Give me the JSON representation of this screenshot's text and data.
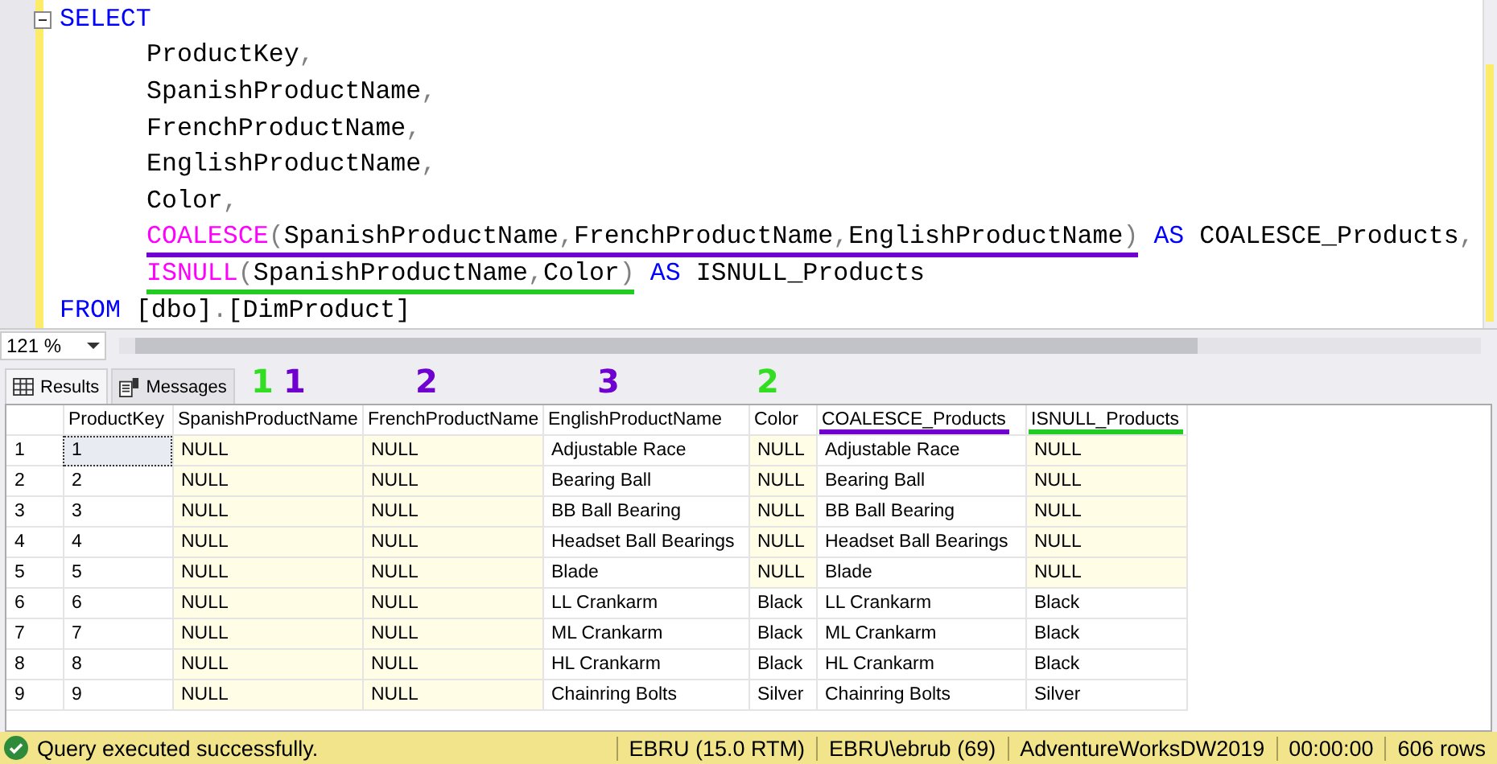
{
  "editor": {
    "lines": [
      {
        "kind": "clause",
        "segments": [
          {
            "tokens": [
              {
                "kind": "keyword",
                "text": "SELECT"
              }
            ]
          }
        ]
      },
      {
        "kind": "item",
        "segments": [
          {
            "tokens": [
              {
                "kind": "plain",
                "text": "ProductKey"
              },
              {
                "kind": "gray",
                "text": ","
              }
            ]
          }
        ]
      },
      {
        "kind": "item",
        "segments": [
          {
            "tokens": [
              {
                "kind": "plain",
                "text": "SpanishProductName"
              },
              {
                "kind": "gray",
                "text": ","
              }
            ]
          }
        ]
      },
      {
        "kind": "item",
        "segments": [
          {
            "tokens": [
              {
                "kind": "plain",
                "text": "FrenchProductName"
              },
              {
                "kind": "gray",
                "text": ","
              }
            ]
          }
        ]
      },
      {
        "kind": "item",
        "segments": [
          {
            "tokens": [
              {
                "kind": "plain",
                "text": "EnglishProductName"
              },
              {
                "kind": "gray",
                "text": ","
              }
            ]
          }
        ]
      },
      {
        "kind": "item",
        "segments": [
          {
            "tokens": [
              {
                "kind": "plain",
                "text": "Color"
              },
              {
                "kind": "gray",
                "text": ","
              }
            ]
          }
        ]
      },
      {
        "kind": "item",
        "segments": [
          {
            "color": "#7000d0",
            "tokens": [
              {
                "kind": "func",
                "text": "COALESCE"
              },
              {
                "kind": "gray",
                "text": "("
              },
              {
                "kind": "plain",
                "text": "SpanishProductName"
              },
              {
                "kind": "gray",
                "text": ","
              },
              {
                "kind": "plain",
                "text": "FrenchProductName"
              },
              {
                "kind": "gray",
                "text": ","
              },
              {
                "kind": "plain",
                "text": "EnglishProductName"
              },
              {
                "kind": "gray",
                "text": ")"
              }
            ]
          },
          {
            "tokens": [
              {
                "kind": "keyword",
                "text": " AS"
              },
              {
                "kind": "plain",
                "text": " COALESCE_Products"
              },
              {
                "kind": "gray",
                "text": ","
              }
            ]
          }
        ]
      },
      {
        "kind": "item",
        "segments": [
          {
            "color": "#22cc22",
            "tokens": [
              {
                "kind": "func",
                "text": "ISNULL"
              },
              {
                "kind": "gray",
                "text": "("
              },
              {
                "kind": "plain",
                "text": "SpanishProductName"
              },
              {
                "kind": "gray",
                "text": ","
              },
              {
                "kind": "plain",
                "text": "Color"
              },
              {
                "kind": "gray",
                "text": ")"
              }
            ]
          },
          {
            "tokens": [
              {
                "kind": "keyword",
                "text": " AS"
              },
              {
                "kind": "plain",
                "text": " ISNULL_Products"
              }
            ]
          }
        ]
      },
      {
        "kind": "clause",
        "segments": [
          {
            "tokens": [
              {
                "kind": "keyword",
                "text": "FROM"
              },
              {
                "kind": "plain",
                "text": " [dbo]"
              },
              {
                "kind": "gray",
                "text": "."
              },
              {
                "kind": "plain",
                "text": "[DimProduct]"
              }
            ]
          }
        ]
      }
    ]
  },
  "zoom": "121 %",
  "tabs": [
    {
      "label": "Results",
      "selected": true,
      "kind": "grid"
    },
    {
      "label": "Messages",
      "selected": false,
      "kind": "messages"
    }
  ],
  "columns": [
    {
      "name": "ProductKey"
    },
    {
      "name": "SpanishProductName",
      "notes": [
        {
          "text": "1",
          "color": "#33dd22"
        },
        {
          "text": "1",
          "color": "#7000d0"
        }
      ]
    },
    {
      "name": "FrenchProductName",
      "notes": [
        {
          "text": "2",
          "color": "#7000d0"
        }
      ]
    },
    {
      "name": "EnglishProductName",
      "notes": [
        {
          "text": "3",
          "color": "#7000d0"
        }
      ]
    },
    {
      "name": "Color",
      "notes": [
        {
          "text": "2",
          "color": "#33dd22"
        }
      ]
    },
    {
      "name": "COALESCE_Products",
      "color": "#7000d0"
    },
    {
      "name": "ISNULL_Products",
      "color": "#22cc22"
    }
  ],
  "rows": [
    {
      "num": "1",
      "selected": true,
      "cells": [
        {
          "text": "1",
          "null": false
        },
        {
          "text": "NULL",
          "null": true
        },
        {
          "text": "NULL",
          "null": true
        },
        {
          "text": "Adjustable Race",
          "null": false
        },
        {
          "text": "NULL",
          "null": true
        },
        {
          "text": "Adjustable Race",
          "null": false
        },
        {
          "text": "NULL",
          "null": true
        }
      ]
    },
    {
      "num": "2",
      "selected": false,
      "cells": [
        {
          "text": "2",
          "null": false
        },
        {
          "text": "NULL",
          "null": true
        },
        {
          "text": "NULL",
          "null": true
        },
        {
          "text": "Bearing Ball",
          "null": false
        },
        {
          "text": "NULL",
          "null": true
        },
        {
          "text": "Bearing Ball",
          "null": false
        },
        {
          "text": "NULL",
          "null": true
        }
      ]
    },
    {
      "num": "3",
      "selected": false,
      "cells": [
        {
          "text": "3",
          "null": false
        },
        {
          "text": "NULL",
          "null": true
        },
        {
          "text": "NULL",
          "null": true
        },
        {
          "text": "BB Ball Bearing",
          "null": false
        },
        {
          "text": "NULL",
          "null": true
        },
        {
          "text": "BB Ball Bearing",
          "null": false
        },
        {
          "text": "NULL",
          "null": true
        }
      ]
    },
    {
      "num": "4",
      "selected": false,
      "cells": [
        {
          "text": "4",
          "null": false
        },
        {
          "text": "NULL",
          "null": true
        },
        {
          "text": "NULL",
          "null": true
        },
        {
          "text": "Headset Ball Bearings",
          "null": false
        },
        {
          "text": "NULL",
          "null": true
        },
        {
          "text": "Headset Ball Bearings",
          "null": false
        },
        {
          "text": "NULL",
          "null": true
        }
      ]
    },
    {
      "num": "5",
      "selected": false,
      "cells": [
        {
          "text": "5",
          "null": false
        },
        {
          "text": "NULL",
          "null": true
        },
        {
          "text": "NULL",
          "null": true
        },
        {
          "text": "Blade",
          "null": false
        },
        {
          "text": "NULL",
          "null": true
        },
        {
          "text": "Blade",
          "null": false
        },
        {
          "text": "NULL",
          "null": true
        }
      ]
    },
    {
      "num": "6",
      "selected": false,
      "cells": [
        {
          "text": "6",
          "null": false
        },
        {
          "text": "NULL",
          "null": true
        },
        {
          "text": "NULL",
          "null": true
        },
        {
          "text": "LL Crankarm",
          "null": false
        },
        {
          "text": "Black",
          "null": false
        },
        {
          "text": "LL Crankarm",
          "null": false
        },
        {
          "text": "Black",
          "null": false
        }
      ]
    },
    {
      "num": "7",
      "selected": false,
      "cells": [
        {
          "text": "7",
          "null": false
        },
        {
          "text": "NULL",
          "null": true
        },
        {
          "text": "NULL",
          "null": true
        },
        {
          "text": "ML Crankarm",
          "null": false
        },
        {
          "text": "Black",
          "null": false
        },
        {
          "text": "ML Crankarm",
          "null": false
        },
        {
          "text": "Black",
          "null": false
        }
      ]
    },
    {
      "num": "8",
      "selected": false,
      "cells": [
        {
          "text": "8",
          "null": false
        },
        {
          "text": "NULL",
          "null": true
        },
        {
          "text": "NULL",
          "null": true
        },
        {
          "text": "HL Crankarm",
          "null": false
        },
        {
          "text": "Black",
          "null": false
        },
        {
          "text": "HL Crankarm",
          "null": false
        },
        {
          "text": "Black",
          "null": false
        }
      ]
    },
    {
      "num": "9",
      "selected": false,
      "cells": [
        {
          "text": "9",
          "null": false
        },
        {
          "text": "NULL",
          "null": true
        },
        {
          "text": "NULL",
          "null": true
        },
        {
          "text": "Chainring Bolts",
          "null": false
        },
        {
          "text": "Silver",
          "null": false
        },
        {
          "text": "Chainring Bolts",
          "null": false
        },
        {
          "text": "Silver",
          "null": false
        }
      ]
    }
  ],
  "status_bar": {
    "message": "Query executed successfully.",
    "items": [
      "EBRU (15.0 RTM)",
      "EBRU\\ebrub (69)",
      "AdventureWorksDW2019",
      "00:00:00",
      "606 rows"
    ]
  }
}
